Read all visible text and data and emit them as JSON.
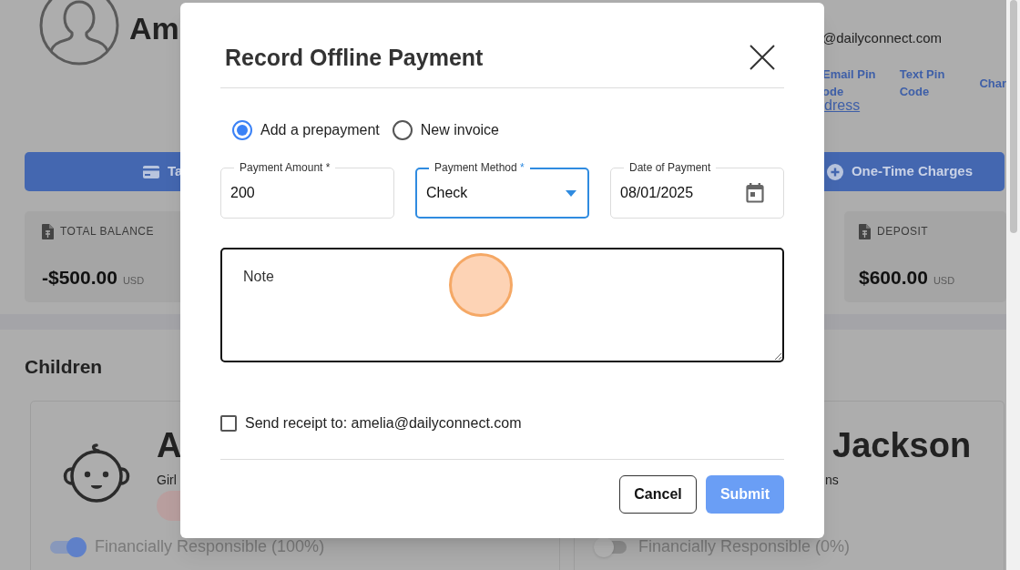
{
  "background": {
    "profile_name": "Am",
    "email": "@dailyconnect.com",
    "links": [
      {
        "lines": [
          "Email Pin",
          "ode"
        ]
      },
      {
        "lines": [
          "Text Pin",
          "Code"
        ]
      },
      {
        "lines": [
          "Char"
        ]
      }
    ],
    "address_link": "dress",
    "action_buttons": [
      {
        "kind": "card",
        "label": "Ta"
      },
      {
        "kind": "plus",
        "label": "One-Time Charges"
      }
    ],
    "stats": [
      {
        "label": "TOTAL BALANCE",
        "amount": "-$500.00",
        "currency": "USD"
      },
      {
        "label": "DEPOSIT",
        "amount": "$600.00",
        "currency": "USD"
      }
    ],
    "children_heading": "Children",
    "children": [
      {
        "kind": "girl",
        "name": "A",
        "detail": "Girl",
        "responsibility": "Financially Responsible (100%)",
        "on": true
      },
      {
        "kind": "other",
        "name": "Jackson",
        "detail": "ns",
        "responsibility": "Financially Responsible (0%)",
        "on": false
      }
    ]
  },
  "dialog": {
    "title": "Record Offline Payment",
    "payment_type": [
      {
        "label": "Add a prepayment",
        "selected": true
      },
      {
        "label": "New invoice",
        "selected": false
      }
    ],
    "fields": [
      {
        "kind": "text",
        "label": "Payment Amount",
        "required_mark": "*",
        "value": "200",
        "focused": false
      },
      {
        "kind": "select",
        "label": "Payment Method",
        "required_mark": "*",
        "value": "Check",
        "focused": true
      },
      {
        "kind": "date",
        "label": "Date of Payment",
        "value": "08/01/2025",
        "focused": false
      }
    ],
    "note": {
      "placeholder": "Note"
    },
    "receipt": {
      "label": "Send receipt to: amelia@dailyconnect.com",
      "checked": false
    },
    "buttons": [
      {
        "kind": "secondary",
        "label": "Cancel"
      },
      {
        "kind": "primary",
        "label": "Submit"
      }
    ]
  }
}
